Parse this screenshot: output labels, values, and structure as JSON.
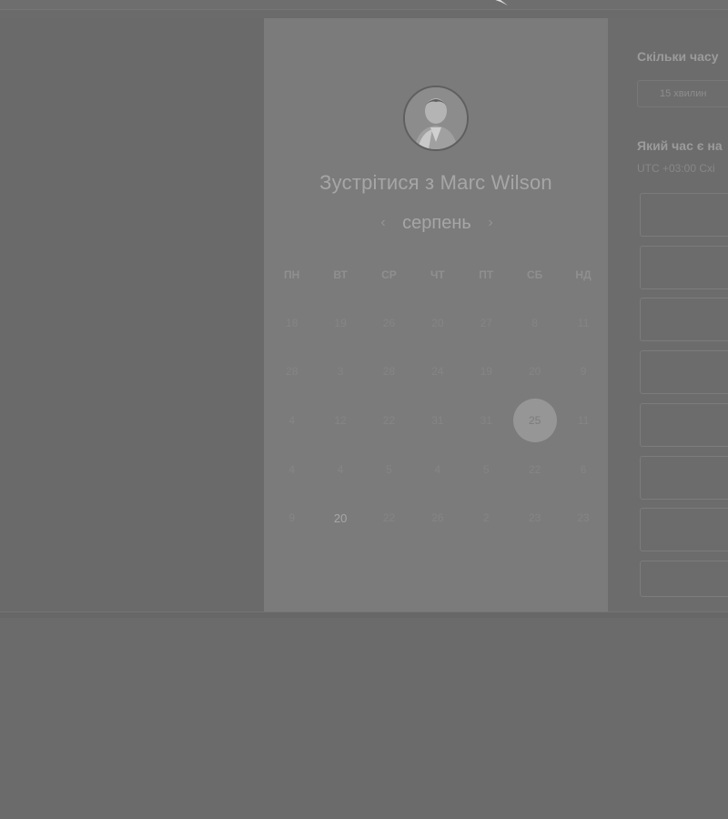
{
  "meeting": {
    "title": "Зустрітися з Marc Wilson",
    "avatar_icon": "person-photo-icon"
  },
  "calendar": {
    "month": "серпень",
    "prev_icon": "chevron-left-icon",
    "next_icon": "chevron-right-icon",
    "weekdays": [
      "ПН",
      "ВТ",
      "СР",
      "ЧТ",
      "ПТ",
      "СБ",
      "НД"
    ],
    "weeks": [
      [
        "18",
        "19",
        "26",
        "20",
        "27",
        "8",
        "11"
      ],
      [
        "28",
        "3",
        "28",
        "24",
        "19",
        "20",
        "9"
      ],
      [
        "4",
        "12",
        "22",
        "31",
        "31",
        "25",
        "11"
      ],
      [
        "4",
        "4",
        "5",
        "4",
        "5",
        "22",
        "6"
      ],
      [
        "9",
        "20",
        "22",
        "26",
        "2",
        "23",
        "23"
      ]
    ],
    "selected_day": "25",
    "available_day": "20"
  },
  "booking": {
    "duration_question": "Скільки часу",
    "duration_value": "15 хвилин",
    "time_question": "Який час є на",
    "timezone": "UTC +03:00 Схі"
  }
}
